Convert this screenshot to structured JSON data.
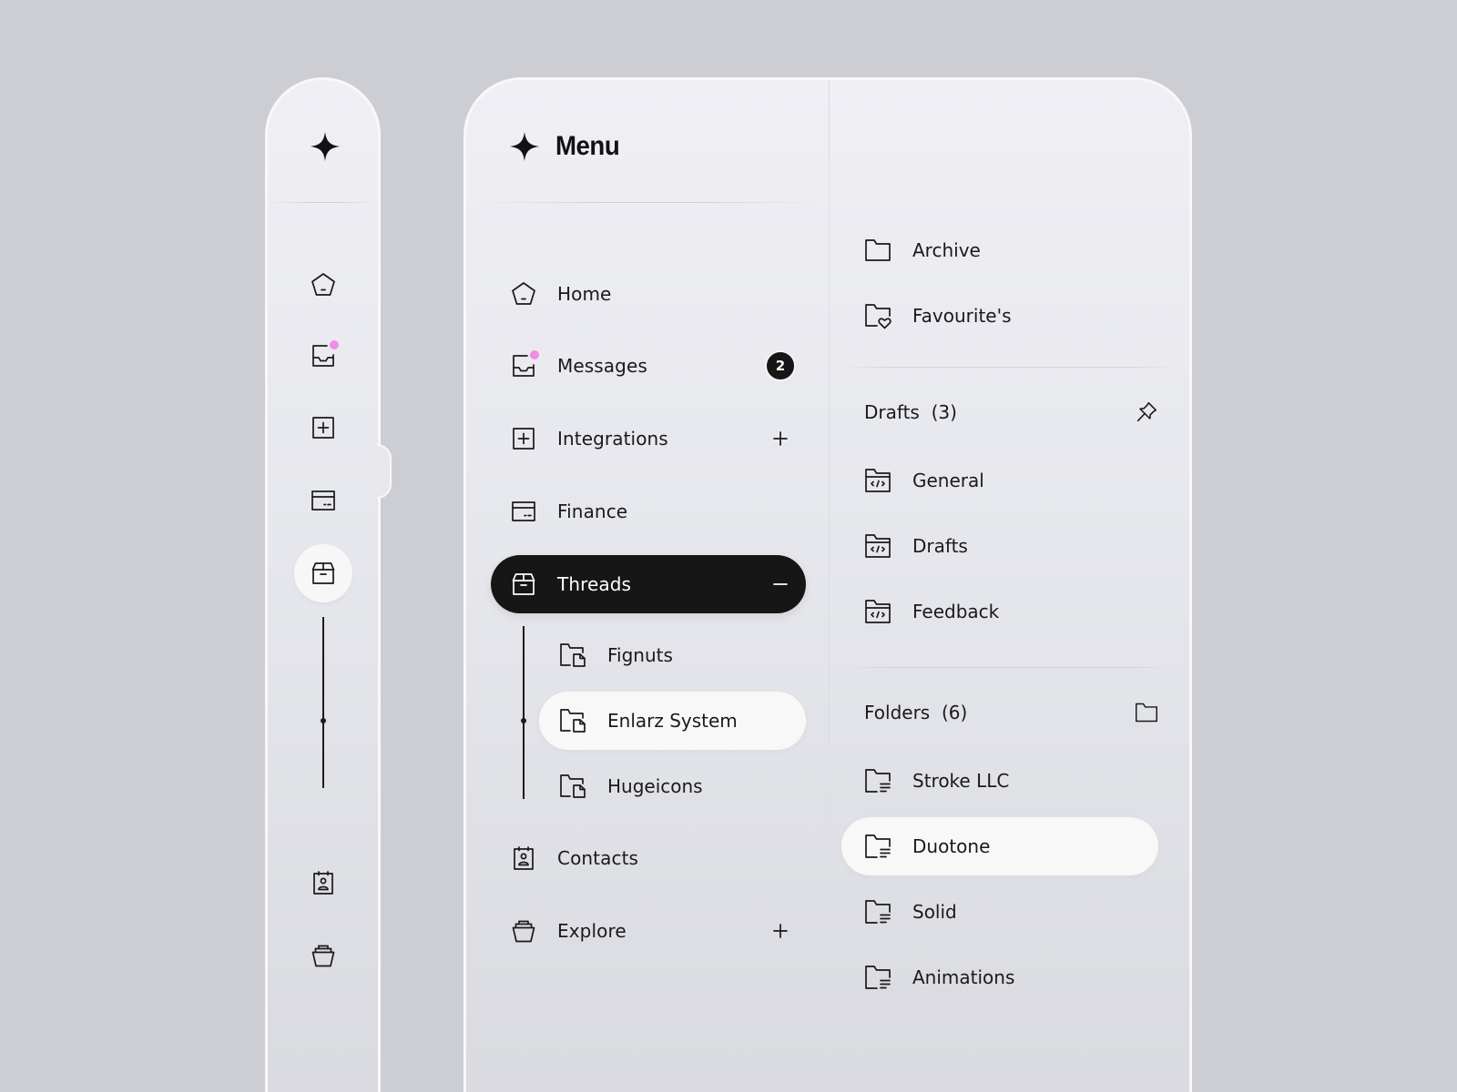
{
  "colors": {
    "background": "#cdced3",
    "panel_top": "#efeff4",
    "panel_bottom": "#d9dadf",
    "active_item": "#161616",
    "selected_item": "#f8f8f9",
    "notification_dot": "#f08ee6",
    "text": "#1a1a1a"
  },
  "rail": {
    "logo_icon": "sparkle-icon",
    "items": [
      {
        "name": "home",
        "icon": "pentagon-home-icon",
        "active": false
      },
      {
        "name": "messages",
        "icon": "inbox-icon",
        "has_notification": true,
        "active": false
      },
      {
        "name": "integrations",
        "icon": "plus-square-icon",
        "active": false
      },
      {
        "name": "finance",
        "icon": "card-icon",
        "active": false
      },
      {
        "name": "threads",
        "icon": "box-icon",
        "active": true
      },
      {
        "name": "contacts",
        "icon": "contact-card-icon",
        "active": false
      },
      {
        "name": "explore",
        "icon": "basket-icon",
        "active": false
      }
    ]
  },
  "menu": {
    "title": "Menu",
    "logo_icon": "sparkle-icon",
    "items": [
      {
        "label": "Home",
        "icon": "pentagon-home-icon"
      },
      {
        "label": "Messages",
        "icon": "inbox-icon",
        "badge": "2",
        "has_notification": true
      },
      {
        "label": "Integrations",
        "icon": "plus-square-icon",
        "trailing": "plus-icon"
      },
      {
        "label": "Finance",
        "icon": "card-icon"
      },
      {
        "label": "Threads",
        "icon": "box-icon",
        "trailing": "minus-icon",
        "active": true
      },
      {
        "label": "Contacts",
        "icon": "contact-card-icon"
      },
      {
        "label": "Explore",
        "icon": "basket-icon",
        "trailing": "plus-icon"
      }
    ],
    "threads_children": [
      {
        "label": "Fignuts",
        "icon": "folder-file-icon"
      },
      {
        "label": "Enlarz System",
        "icon": "folder-file-icon",
        "selected": true
      },
      {
        "label": "Hugeicons",
        "icon": "folder-file-icon"
      }
    ]
  },
  "secondary": {
    "top_items": [
      {
        "label": "Archive",
        "icon": "folder-icon"
      },
      {
        "label": "Favourite's",
        "icon": "folder-heart-icon"
      }
    ],
    "drafts": {
      "title": "Drafts",
      "count": "(3)",
      "action_icon": "pin-icon",
      "items": [
        {
          "label": "General",
          "icon": "folder-code-icon"
        },
        {
          "label": "Drafts",
          "icon": "folder-code-icon"
        },
        {
          "label": "Feedback",
          "icon": "folder-code-icon"
        }
      ]
    },
    "folders": {
      "title": "Folders",
      "count": "(6)",
      "action_icon": "folder-icon",
      "items": [
        {
          "label": "Stroke LLC",
          "icon": "folder-lines-icon"
        },
        {
          "label": "Duotone",
          "icon": "folder-lines-icon",
          "selected": true
        },
        {
          "label": "Solid",
          "icon": "folder-lines-icon"
        },
        {
          "label": "Animations",
          "icon": "folder-lines-icon"
        }
      ]
    }
  }
}
